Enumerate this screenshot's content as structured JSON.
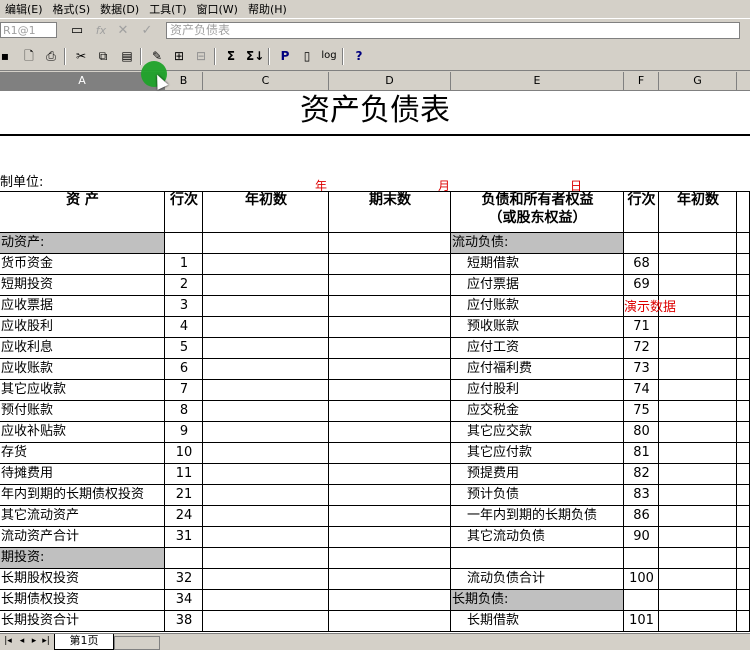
{
  "menu": [
    "编辑(E)",
    "格式(S)",
    "数据(D)",
    "工具(T)",
    "窗口(W)",
    "帮助(H)"
  ],
  "formula": {
    "cell_ref": "R1@1",
    "fx": "fx",
    "content": "资产负债表"
  },
  "toolbar_icons": [
    "save-icon",
    "print-preview-icon",
    "print-icon",
    "cut-icon",
    "copy-icon",
    "paste-icon",
    "format-painter-icon",
    "insert-icon",
    "delete-icon",
    "sum-icon",
    "sort-icon",
    "p-icon",
    "page-icon",
    "log-icon",
    "help-icon"
  ],
  "toolbar_labels": {
    "sum": "Σ",
    "sum2": "Σ↓",
    "p": "P",
    "log": "log",
    "help": "?"
  },
  "columns": [
    "A",
    "B",
    "C",
    "D",
    "E",
    "F",
    "G"
  ],
  "sheet": {
    "title": "资产负债表",
    "unit_label": "制单位:",
    "date": {
      "year": "年",
      "month": "月",
      "day": "日"
    },
    "headers": {
      "asset": "资    产",
      "row_no": "行次",
      "begin": "年初数",
      "end": "期末数",
      "liab_line1": "负债和所有者权益",
      "liab_line2": "（或股东权益）",
      "row_no2": "行次",
      "begin2": "年初数"
    },
    "rows": [
      {
        "a": "动资产:",
        "b": "",
        "e": "流动负债:",
        "f": "",
        "a_gray": true,
        "e_gray": true
      },
      {
        "a": "货币资金",
        "b": "1",
        "e": "短期借款",
        "f": "68"
      },
      {
        "a": "短期投资",
        "b": "2",
        "e": "应付票据",
        "f": "69"
      },
      {
        "a": "应收票据",
        "b": "3",
        "e": "应付账款",
        "f": ""
      },
      {
        "a": "应收股利",
        "b": "4",
        "e": "预收账款",
        "f": "71"
      },
      {
        "a": "应收利息",
        "b": "5",
        "e": "应付工资",
        "f": "72"
      },
      {
        "a": "应收账款",
        "b": "6",
        "e": "应付福利费",
        "f": "73"
      },
      {
        "a": "其它应收款",
        "b": "7",
        "e": "应付股利",
        "f": "74"
      },
      {
        "a": "预付账款",
        "b": "8",
        "e": "应交税金",
        "f": "75"
      },
      {
        "a": "应收补贴款",
        "b": "9",
        "e": "其它应交款",
        "f": "80"
      },
      {
        "a": "存货",
        "b": "10",
        "e": "其它应付款",
        "f": "81"
      },
      {
        "a": "待摊费用",
        "b": "11",
        "e": "预提费用",
        "f": "82"
      },
      {
        "a": "年内到期的长期债权投资",
        "b": "21",
        "e": "预计负债",
        "f": "83"
      },
      {
        "a": "其它流动资产",
        "b": "24",
        "e": "一年内到期的长期负债",
        "f": "86"
      },
      {
        "a": "流动资产合计",
        "b": "31",
        "e": "其它流动负债",
        "f": "90"
      },
      {
        "a": "期投资:",
        "b": "",
        "e": "",
        "f": "",
        "a_gray": true
      },
      {
        "a": "长期股权投资",
        "b": "32",
        "e": "流动负债合计",
        "f": "100"
      },
      {
        "a": "长期债权投资",
        "b": "34",
        "e": "长期负债:",
        "f": "",
        "e_gray": true,
        "e_noindent": true
      },
      {
        "a": "长期投资合计",
        "b": "38",
        "e": "长期借款",
        "f": "101"
      }
    ],
    "demo_text": "演示数据"
  },
  "tabs": {
    "active": "第1页"
  }
}
